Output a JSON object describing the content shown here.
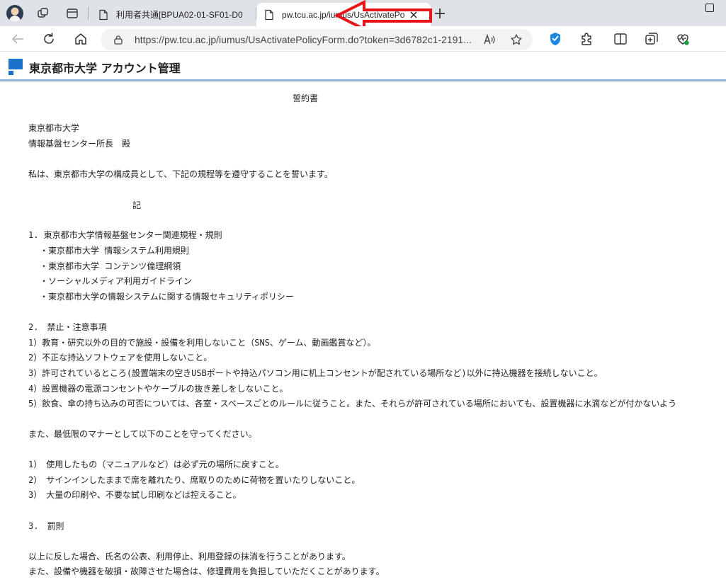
{
  "browser": {
    "tabs": [
      {
        "title": "利用者共通[BPUA02-01-SF01-D0",
        "active": false
      },
      {
        "title": "pw.tcu.ac.jp/iumus/UsActivatePo",
        "active": true
      }
    ],
    "url": "https://pw.tcu.ac.jp/iumus/UsActivatePolicyForm.do?token=3d6782c1-2191...",
    "annotation_color": "#e8141b"
  },
  "site": {
    "title": "東京都市大学 アカウント管理",
    "brand_color": "#1a73c9",
    "header_rule_color": "#8fb3d8"
  },
  "document": {
    "title": "誓約書",
    "addressee": [
      "東京都市大学",
      "情報基盤センター所長　殿"
    ],
    "pledge": "私は、東京都市大学の構成員として、下記の規程等を遵守することを誓います。",
    "ki": "記",
    "section1": {
      "heading": "1. 東京都市大学情報基盤センター関連規程・規則",
      "items": [
        "・東京都市大学 情報システム利用規則",
        "・東京都市大学 コンテンツ倫理綱領",
        "・ソーシャルメディア利用ガイドライン",
        "・東京都市大学の情報システムに関する情報セキュリティポリシー"
      ]
    },
    "section2": {
      "heading": "2.　禁止・注意事項",
      "items": [
        "1）教育・研究以外の目的で施設・設備を利用しないこと（SNS、ゲーム、動画鑑賞など）。",
        "2）不正な持込ソフトウェアを使用しないこと。",
        "3）許可されているところ(設置端末の空きUSBポートや持込パソコン用に机上コンセントが配されている場所など)以外に持込機器を接続しないこと。",
        "4）設置機器の電源コンセントやケーブルの抜き差しをしないこと。",
        "5）飲食、傘の持ち込みの可否については、各室・スペースごとのルールに従うこと。また、それらが許可されている場所においても、設置機器に水滴などが付かないよう"
      ],
      "manners_intro": "また、最低限のマナーとして以下のことを守ってください。",
      "manners": [
        "1）　使用したもの（マニュアルなど）は必ず元の場所に戻すこと。",
        "2）　サインインしたままで席を離れたり、席取りのために荷物を置いたりしないこと。",
        "3）　大量の印刷や、不要な試し印刷などは控えること。"
      ]
    },
    "section3": {
      "heading": "3.　罰則",
      "lines": [
        "以上に反した場合、氏名の公表、利用停止、利用登録の抹消を行うことがあります。",
        "また、設備や機器を破損・故障させた場合は、修理費用を負担していただくことがあります。"
      ]
    }
  }
}
